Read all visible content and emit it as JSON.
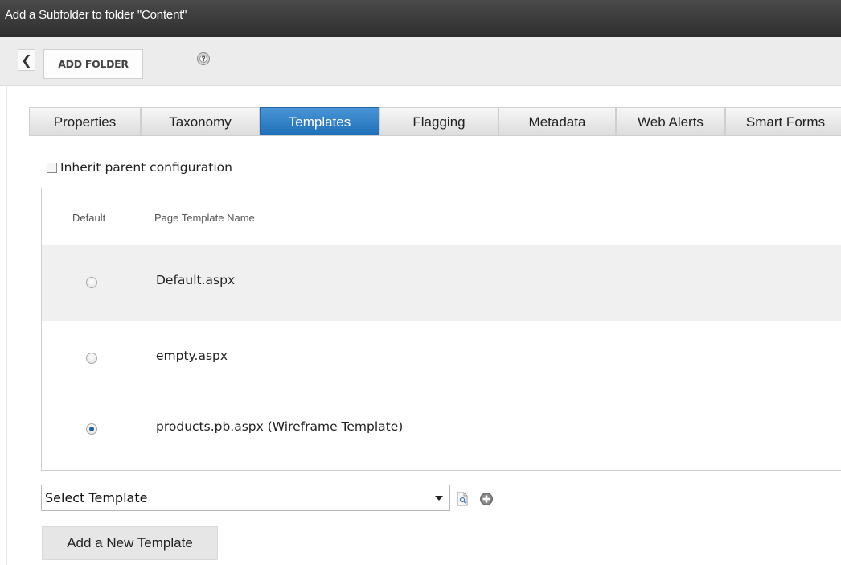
{
  "window": {
    "title": "Add a Subfolder to folder \"Content\""
  },
  "toolbar": {
    "back_icon": "chevron-left-icon",
    "add_folder_label": "ADD FOLDER",
    "help_icon": "help-icon"
  },
  "tabs": [
    {
      "label": "Properties"
    },
    {
      "label": "Taxonomy"
    },
    {
      "label": "Templates",
      "active": true
    },
    {
      "label": "Flagging"
    },
    {
      "label": "Metadata"
    },
    {
      "label": "Web Alerts"
    },
    {
      "label": "Smart Forms"
    }
  ],
  "inherit": {
    "label": "Inherit parent configuration",
    "checked": false
  },
  "templates_table": {
    "headers": {
      "default": "Default",
      "name": "Page Template Name"
    },
    "rows": [
      {
        "name": "Default.aspx",
        "selected": false
      },
      {
        "name": "empty.aspx",
        "selected": false
      },
      {
        "name": "products.pb.aspx (Wireframe Template)",
        "selected": true
      }
    ]
  },
  "template_select": {
    "value": "Select Template"
  },
  "icons": {
    "preview": "preview-document-icon",
    "add": "add-circle-icon"
  },
  "add_template_label": "Add a New Template",
  "colors": {
    "active_tab": "#1c6fb8",
    "titlebar": "#2e2e2e"
  }
}
